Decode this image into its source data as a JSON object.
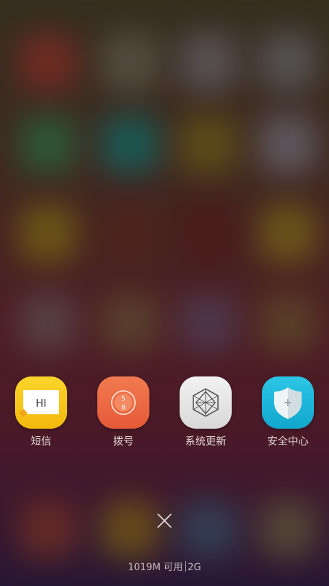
{
  "recent_apps": [
    {
      "label": "短信",
      "icon": "message-icon",
      "icon_text": "HI",
      "color": "#f5c418"
    },
    {
      "label": "拨号",
      "icon": "dialer-icon",
      "icon_text_top": "5",
      "icon_text_bottom": "8",
      "color": "#ee6a44"
    },
    {
      "label": "系统更新",
      "icon": "system-update-icon",
      "color": "#e6e6e6"
    },
    {
      "label": "安全中心",
      "icon": "security-center-icon",
      "color": "#1fb8dc"
    }
  ],
  "close_button": {
    "icon": "close-icon"
  },
  "memory": {
    "available": "1019M 可用",
    "total": "2G"
  }
}
